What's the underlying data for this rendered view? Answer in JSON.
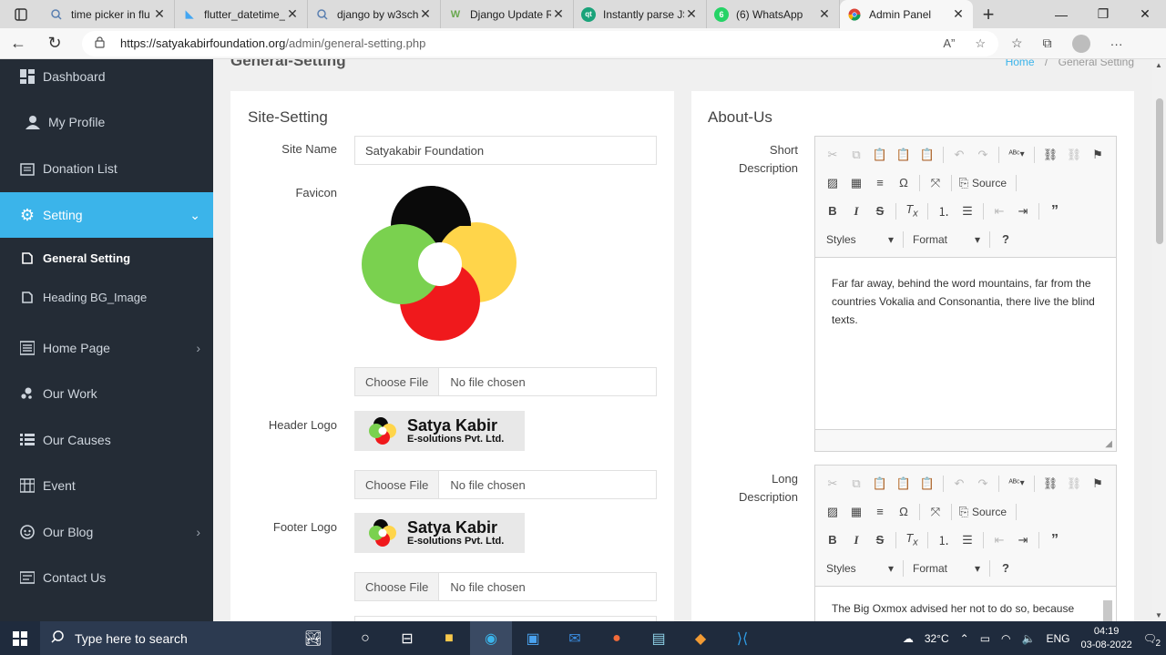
{
  "browser": {
    "tabs": [
      {
        "title": "time picker in flu",
        "favicon": "search-icon"
      },
      {
        "title": "flutter_datetime_",
        "favicon": "flutter-icon"
      },
      {
        "title": "django by w3sch",
        "favicon": "search-icon"
      },
      {
        "title": "Django Update R",
        "favicon": "w-icon"
      },
      {
        "title": "Instantly parse JS",
        "favicon": "qt-icon"
      },
      {
        "title": "(6) WhatsApp",
        "favicon": "whatsapp-icon"
      },
      {
        "title": "Admin Panel",
        "favicon": "chrome-icon",
        "active": true
      }
    ],
    "url_host": "https://satyakabirfoundation.org",
    "url_path": "/admin/general-setting.php"
  },
  "sidebar": {
    "items": [
      {
        "label": "Dashboard",
        "icon": "dashboard-icon"
      },
      {
        "label": "My Profile",
        "icon": "user-icon"
      },
      {
        "label": "Donation List",
        "icon": "donation-icon"
      },
      {
        "label": "Setting",
        "icon": "gear-icon",
        "active": true
      },
      {
        "label": "General Setting",
        "icon": "page-icon",
        "sub": true
      },
      {
        "label": "Heading BG_Image",
        "icon": "page-icon",
        "sub": true
      },
      {
        "label": "Home Page",
        "icon": "list-icon"
      },
      {
        "label": "Our Work",
        "icon": "work-icon"
      },
      {
        "label": "Our Causes",
        "icon": "causes-icon"
      },
      {
        "label": "Event",
        "icon": "event-icon"
      },
      {
        "label": "Our Blog",
        "icon": "blog-icon"
      },
      {
        "label": "Contact Us",
        "icon": "contact-icon"
      }
    ]
  },
  "header": {
    "title": "General-Setting",
    "breadcrumb_home": "Home",
    "breadcrumb_sep": "/",
    "breadcrumb_current": "General Setting"
  },
  "site_setting": {
    "title": "Site-Setting",
    "site_name_label": "Site Name",
    "site_name_value": "Satyakabir Foundation",
    "favicon_label": "Favicon",
    "header_logo_label": "Header Logo",
    "footer_logo_label": "Footer Logo",
    "choose_file": "Choose File",
    "no_file": "No file chosen",
    "logo_line1": "Satya Kabir",
    "logo_line2": "E-solutions Pvt. Ltd."
  },
  "about_us": {
    "title": "About-Us",
    "short_label_1": "Short",
    "short_label_2": "Description",
    "long_label_1": "Long",
    "long_label_2": "Description",
    "short_text": "Far far away, behind the word mountains, far from the countries Vokalia and Consonantia, there live the blind texts.",
    "long_text": "The Big Oxmox advised her not to do so, because",
    "toolbar_source": "Source",
    "toolbar_styles": "Styles",
    "toolbar_format": "Format"
  },
  "taskbar": {
    "search_placeholder": "Type here to search",
    "temperature": "32°C",
    "lang": "ENG",
    "time": "04:19",
    "date": "03-08-2022",
    "notifications": "2"
  }
}
